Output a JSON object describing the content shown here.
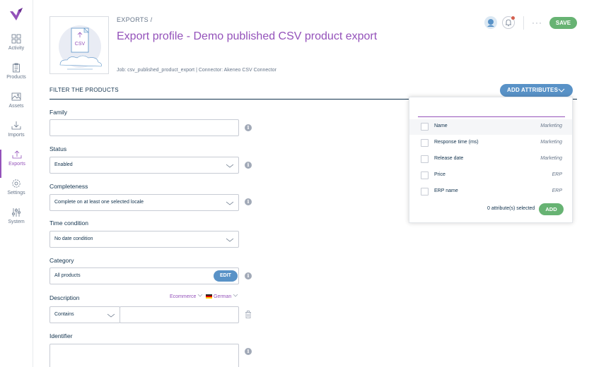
{
  "sidebar": {
    "items": [
      {
        "label": "Activity",
        "icon": "dashboard-icon"
      },
      {
        "label": "Products",
        "icon": "clipboard-icon"
      },
      {
        "label": "Assets",
        "icon": "image-icon"
      },
      {
        "label": "Imports",
        "icon": "import-icon"
      },
      {
        "label": "Exports",
        "icon": "export-icon",
        "active": true
      },
      {
        "label": "Settings",
        "icon": "gear-icon"
      },
      {
        "label": "System",
        "icon": "sliders-icon"
      }
    ]
  },
  "header": {
    "breadcrumb": "EXPORTS /",
    "title": "Export profile - Demo published CSV product export",
    "job_meta": "Job: csv_published_product_export | Connector: Akeneo CSV Connector",
    "thumbnail_text": "CSV",
    "more_label": "···",
    "save_label": "SAVE"
  },
  "filters": {
    "section_title": "FILTER THE PRODUCTS",
    "add_attributes_label": "ADD ATTRIBUTES",
    "family": {
      "label": "Family",
      "value": ""
    },
    "status": {
      "label": "Status",
      "value": "Enabled"
    },
    "completeness": {
      "label": "Completeness",
      "value": "Complete on at least one selected locale"
    },
    "time_condition": {
      "label": "Time condition",
      "value": "No date condition"
    },
    "category": {
      "label": "Category",
      "value": "All products",
      "edit_label": "EDIT"
    },
    "description": {
      "label": "Description",
      "scope": "Ecommerce",
      "locale": "German",
      "operator": "Contains",
      "value": ""
    },
    "identifier": {
      "label": "Identifier",
      "value": ""
    }
  },
  "attribute_panel": {
    "search_value": "",
    "items": [
      {
        "name": "Name",
        "group": "Marketing"
      },
      {
        "name": "Response time (ms)",
        "group": "Marketing"
      },
      {
        "name": "Release date",
        "group": "Marketing"
      },
      {
        "name": "Price",
        "group": "ERP"
      },
      {
        "name": "ERP name",
        "group": "ERP"
      }
    ],
    "selected_count": "0 attribute(s) selected",
    "add_label": "ADD"
  },
  "colors": {
    "brand_purple": "#9452ba",
    "save_green": "#67b373",
    "action_blue": "#5992c7",
    "text_dark": "#11324d",
    "notification_red": "#d4604f"
  }
}
